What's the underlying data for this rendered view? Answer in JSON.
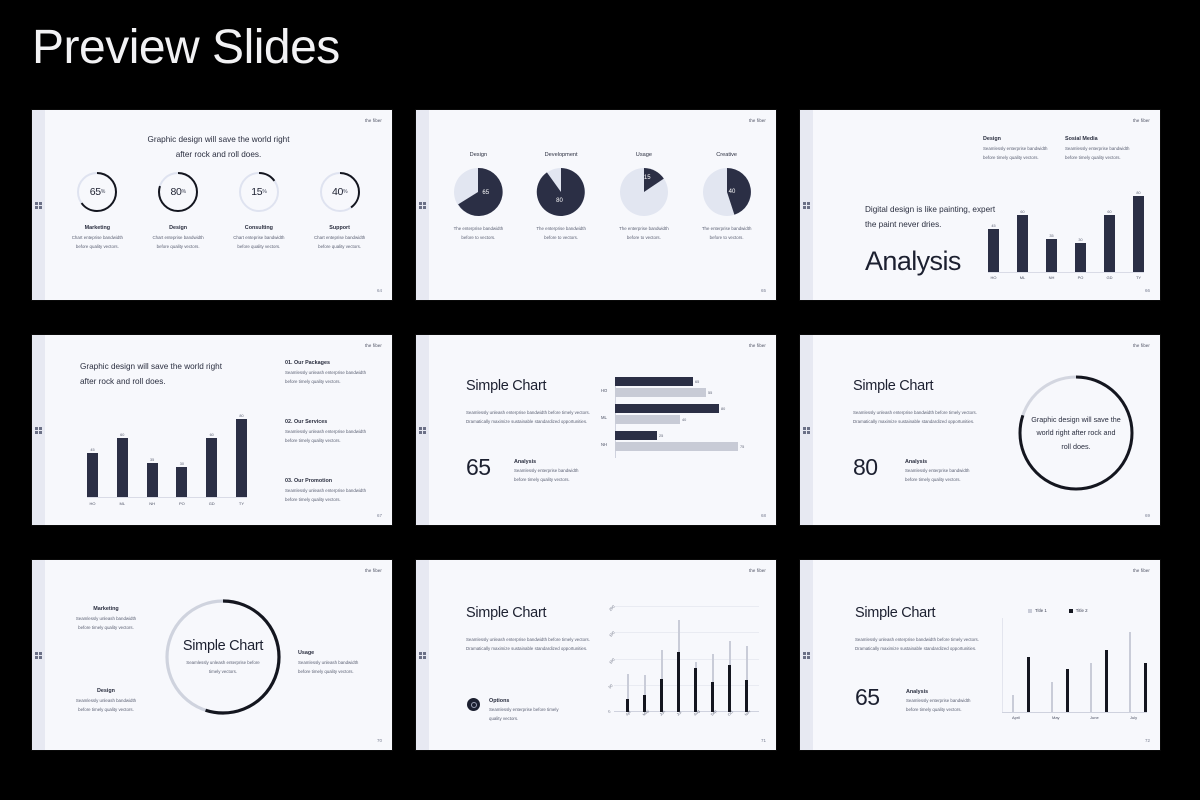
{
  "header": {
    "title": "Preview Slides"
  },
  "brand": "the fiber",
  "slides": [
    {
      "id": "slide-donut-kpis",
      "page": "64",
      "headline_line1": "Graphic design will save the world right",
      "headline_line2": "after rock and roll does.",
      "chart_data": {
        "type": "pie",
        "title": "Percentage donuts",
        "categories": [
          "Marketing",
          "Design",
          "Consulting",
          "Support"
        ],
        "values": [
          65,
          80,
          15,
          40
        ],
        "unit": "%"
      },
      "items": [
        {
          "value": "65",
          "unit": "%",
          "label": "Marketing",
          "desc1": "Chart enteprise bandwidth",
          "desc2": "before quality vectors."
        },
        {
          "value": "80",
          "unit": "%",
          "label": "Design",
          "desc1": "Chart enteprise bandwidth",
          "desc2": "before quality vectors."
        },
        {
          "value": "15",
          "unit": "%",
          "label": "Consulting",
          "desc1": "Chart enteprise bandwidth",
          "desc2": "before quality vectors."
        },
        {
          "value": "40",
          "unit": "%",
          "label": "Support",
          "desc1": "Chart enteprise bandwidth",
          "desc2": "before quality vectors."
        }
      ]
    },
    {
      "id": "slide-pie-charts",
      "page": "65",
      "chart_data": {
        "type": "pie",
        "title": "Pie segments",
        "categories": [
          "Design",
          "Development",
          "Usage",
          "Creative"
        ],
        "values": [
          65,
          80,
          15,
          40
        ]
      },
      "items": [
        {
          "title": "Design",
          "value": "65",
          "desc1": "The enterprise bandwidth",
          "desc2": "before to vectors."
        },
        {
          "title": "Development",
          "value": "80",
          "desc1": "The enterprise bandwidth",
          "desc2": "before to vectors."
        },
        {
          "title": "Usage",
          "value": "15",
          "desc1": "The enterprise bandwidth",
          "desc2": "before to vectors."
        },
        {
          "title": "Creative",
          "value": "40",
          "desc1": "The enterprise bandwidth",
          "desc2": "before to vectors."
        }
      ]
    },
    {
      "id": "slide-analysis-bars",
      "page": "66",
      "headline_line1": "Digital design is like painting, expert",
      "headline_line2": "the paint never dries.",
      "bigword": "Analysis",
      "notes": [
        {
          "title": "Design",
          "desc1": "Seamlessly enterprise bandwidth",
          "desc2": "before timely quality vectors."
        },
        {
          "title": "Sosial Media",
          "desc1": "Seamlessly enterprise bandwidth",
          "desc2": "before timely quality vectors."
        }
      ],
      "chart_data": {
        "type": "bar",
        "title": "Analysis",
        "categories": [
          "HO",
          "ML",
          "NH",
          "PO",
          "GD",
          "TY"
        ],
        "values": [
          45,
          60,
          35,
          30,
          60,
          80
        ],
        "ylim": [
          0,
          90
        ],
        "grid": false
      }
    },
    {
      "id": "slide-packages-bars",
      "page": "67",
      "headline_line1": "Graphic design will save the world right",
      "headline_line2": "after rock and roll does.",
      "notes": [
        {
          "title": "01. Our Packages",
          "desc1": "Seamlessly unleash enterprise bandwidth",
          "desc2": "before timely quality vectors."
        },
        {
          "title": "02. Our Services",
          "desc1": "Seamlessly unleash enterprise bandwidth",
          "desc2": "before timely quality vectors."
        },
        {
          "title": "03. Our Promotion",
          "desc1": "Seamlessly unleash enterprise bandwidth",
          "desc2": "before timely quality vectors."
        }
      ],
      "chart_data": {
        "type": "bar",
        "title": "",
        "categories": [
          "HO",
          "ML",
          "NH",
          "PO",
          "GD",
          "TY"
        ],
        "values": [
          45,
          60,
          35,
          30,
          60,
          80
        ],
        "ylim": [
          0,
          90
        ],
        "grid": false
      }
    },
    {
      "id": "slide-hbar-chart",
      "page": "68",
      "title": "Simple Chart",
      "body": "Seamlessly unleash enterprise bandwidth before timely vectors. Dramatically maximize sustainable standardized opportunities.",
      "stat_number": "65",
      "stat_title": "Analysis",
      "stat_desc1": "Seamlessly enterprise bandwidth",
      "stat_desc2": "before timely quality vectors.",
      "chart_data": {
        "type": "bar",
        "orientation": "horizontal",
        "categories": [
          "HO",
          "ML",
          "NH"
        ],
        "series": [
          {
            "name": "Series 1",
            "color": "#2b2f45",
            "values": [
              65,
              80,
              25
            ]
          },
          {
            "name": "Series 2",
            "color": "#c8cbd6",
            "values": [
              55,
              40,
              75
            ]
          }
        ],
        "xlim": [
          0,
          100
        ]
      }
    },
    {
      "id": "slide-ring-quote",
      "page": "69",
      "title": "Simple Chart",
      "body": "Seamlessly unleash enterprise bandwidth before timely vectors. Dramatically maximize sustainable standardized opportunities.",
      "stat_number": "80",
      "stat_title": "Analysis",
      "stat_desc1": "Seamlessly enterprise bandwidth",
      "stat_desc2": "before timely quality vectors.",
      "ring_line1": "Graphic design will save the",
      "ring_line2": "world right after rock and",
      "ring_line3": "roll does.",
      "chart_data": {
        "type": "pie",
        "categories": [
          "Filled",
          "Rest"
        ],
        "values": [
          80,
          20
        ]
      }
    },
    {
      "id": "slide-ring-labels",
      "page": "70",
      "ring_title": "Simple Chart",
      "ring_sub1": "Seamlessly unleash enterprise before",
      "ring_sub2": "timely vectors.",
      "labels": [
        {
          "title": "Marketing",
          "desc1": "Seamlessly unleash bandwidth",
          "desc2": "before timely quality vectors."
        },
        {
          "title": "Design",
          "desc1": "Seamlessly unleash bandwidth",
          "desc2": "before timely quality vectors."
        },
        {
          "title": "Usage",
          "desc1": "Seamlessly unleash bandwidth",
          "desc2": "before timely quality vectors."
        }
      ],
      "chart_data": {
        "type": "pie",
        "categories": [
          "Filled",
          "Rest"
        ],
        "values": [
          55,
          45
        ]
      }
    },
    {
      "id": "slide-stick-chart",
      "page": "71",
      "title": "Simple Chart",
      "body": "Seamlessly unleash enterprise bandwidth before timely vectors. Dramatically maximize sustainable standardized opportunities.",
      "option_title": "Options",
      "option_desc1": "Seamlessly enterprise before timely",
      "option_desc2": "quality vectors.",
      "chart_data": {
        "type": "bar",
        "categories": [
          "Apr",
          "May",
          "Jun",
          "Jul",
          "Aug",
          "Sep",
          "Oct",
          "Nov"
        ],
        "yticks": [
          "0",
          "50",
          "100",
          "150",
          "200"
        ],
        "ylim": [
          0,
          200
        ],
        "series": [
          {
            "name": "Light",
            "color": "#c9ccd8",
            "values": [
              72,
              70,
              118,
              175,
              95,
              110,
              135,
              125
            ]
          },
          {
            "name": "Dark",
            "color": "#14161f",
            "values": [
              25,
              33,
              62,
              115,
              83,
              57,
              90,
              60
            ]
          }
        ],
        "grid": true
      }
    },
    {
      "id": "slide-legend-chart",
      "page": "72",
      "title": "Simple Chart",
      "body": "Seamlessly unleash enterprise bandwidth before timely vectors. Dramatically maximize sustainable standardized opportunities.",
      "stat_number": "65",
      "stat_title": "Analysis",
      "stat_desc1": "Seamlessly enterprise bandwidth",
      "stat_desc2": "before timely quality vectors.",
      "chart_data": {
        "type": "bar",
        "categories": [
          "April",
          "May",
          "June",
          "July"
        ],
        "legend": [
          "Title 1",
          "Title 2"
        ],
        "legend_position": "top-right",
        "series": [
          {
            "name": "Title 1",
            "color": "#c9ccd8",
            "values": [
              18,
              32,
              52,
              85
            ]
          },
          {
            "name": "Title 2",
            "color": "#14161f",
            "values": [
              58,
              45,
              65,
              52
            ]
          }
        ],
        "ylim": [
          0,
          100
        ]
      }
    }
  ]
}
